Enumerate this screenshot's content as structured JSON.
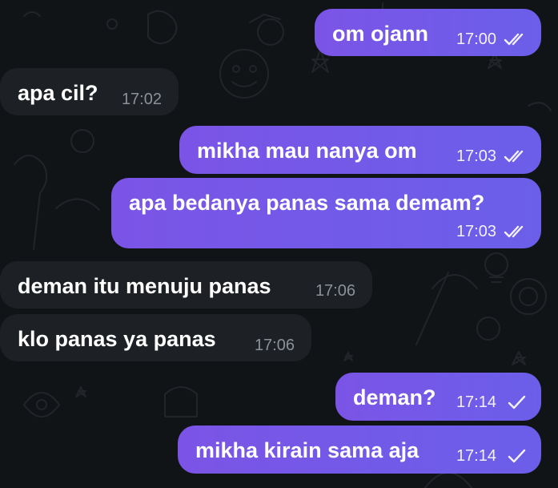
{
  "messages": [
    {
      "direction": "outgoing",
      "text": "om ojann",
      "time": "17:00",
      "status": "read",
      "status_icon": "double-check-icon"
    },
    {
      "direction": "incoming",
      "text": "apa cil?",
      "time": "17:02"
    },
    {
      "direction": "outgoing",
      "text": "mikha mau nanya om",
      "time": "17:03",
      "status": "read",
      "status_icon": "double-check-icon"
    },
    {
      "direction": "outgoing",
      "text": "apa bedanya panas sama demam?",
      "time": "17:03",
      "status": "read",
      "status_icon": "double-check-icon"
    },
    {
      "direction": "incoming",
      "text": "deman itu menuju panas",
      "time": "17:06"
    },
    {
      "direction": "incoming",
      "text": "klo panas ya panas",
      "time": "17:06"
    },
    {
      "direction": "outgoing",
      "text": "deman?",
      "time": "17:14",
      "status": "sent",
      "status_icon": "single-check-icon"
    },
    {
      "direction": "outgoing",
      "text": "mikha kirain sama aja",
      "time": "17:14",
      "status": "sent",
      "status_icon": "single-check-icon"
    }
  ],
  "colors": {
    "background": "#111417",
    "outgoing_bubble_start": "#7b54e6",
    "outgoing_bubble_end": "#6b5fe9",
    "incoming_bubble": "#1d2125",
    "incoming_time": "#8b9197"
  }
}
